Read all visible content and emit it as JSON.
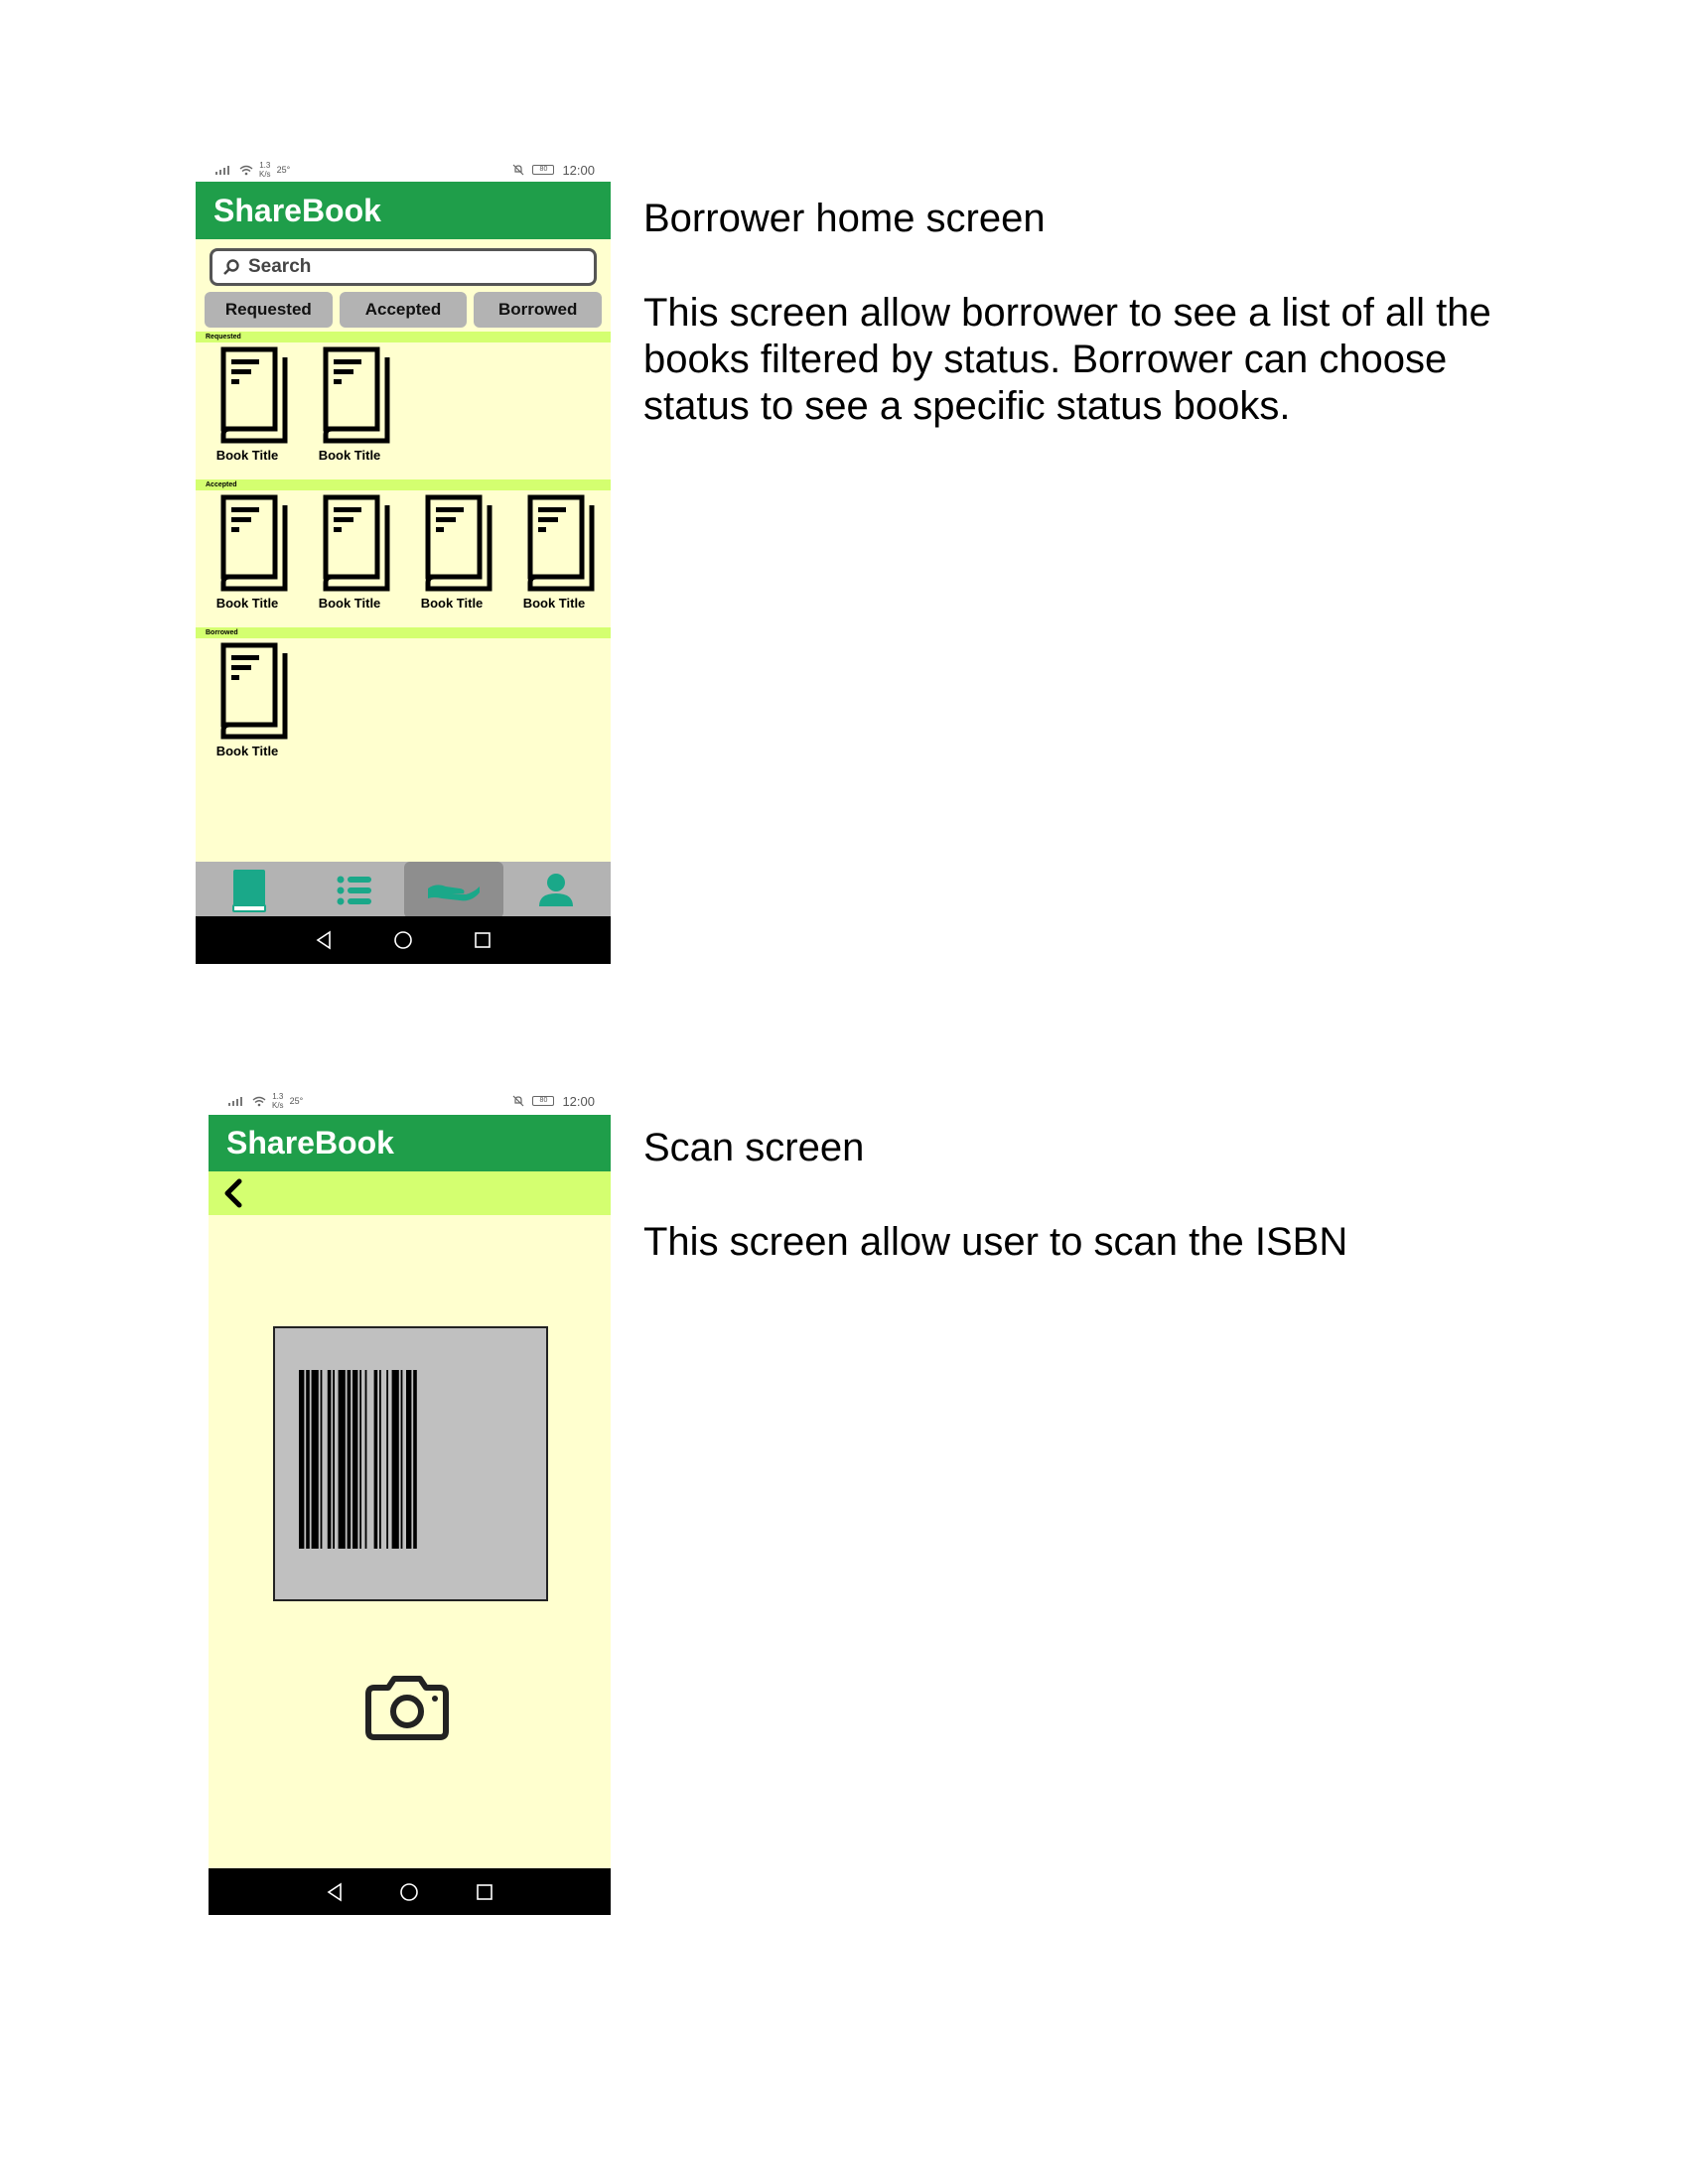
{
  "screen1": {
    "status": {
      "net_speed": "1.3",
      "net_unit": "K/s",
      "temp": "25°",
      "battery": "80",
      "time": "12:00"
    },
    "app_title": "ShareBook",
    "search_placeholder": "Search",
    "tabs": [
      "Requested",
      "Accepted",
      "Borrowed"
    ],
    "sections": [
      {
        "header": "Requested",
        "books": [
          "Book Title",
          "Book Title"
        ]
      },
      {
        "header": "Accepted",
        "books": [
          "Book Title",
          "Book Title",
          "Book Title",
          "Book Title"
        ]
      },
      {
        "header": "Borrowed",
        "books": [
          "Book Title"
        ]
      }
    ],
    "bottom_nav": [
      "book-icon",
      "list-icon",
      "hand-icon",
      "profile-icon"
    ],
    "active_nav": "hand-icon"
  },
  "screen2": {
    "status": {
      "net_speed": "1.3",
      "net_unit": "K/s",
      "temp": "25°",
      "battery": "80",
      "time": "12:00"
    },
    "app_title": "ShareBook"
  },
  "descriptions": {
    "screen1_title": "Borrower home screen",
    "screen1_body": "This screen allow borrower to see a list of all the books filtered by status. Borrower can choose status to see a specific status books.",
    "screen2_title": "Scan screen",
    "screen2_body": "This screen allow user to scan the ISBN"
  },
  "colors": {
    "appbar": "#1f9e4a",
    "section_header": "#d4ff70",
    "background": "#ffffcf",
    "tab": "#b3b3b3",
    "nav_icon": "#1aa889"
  }
}
